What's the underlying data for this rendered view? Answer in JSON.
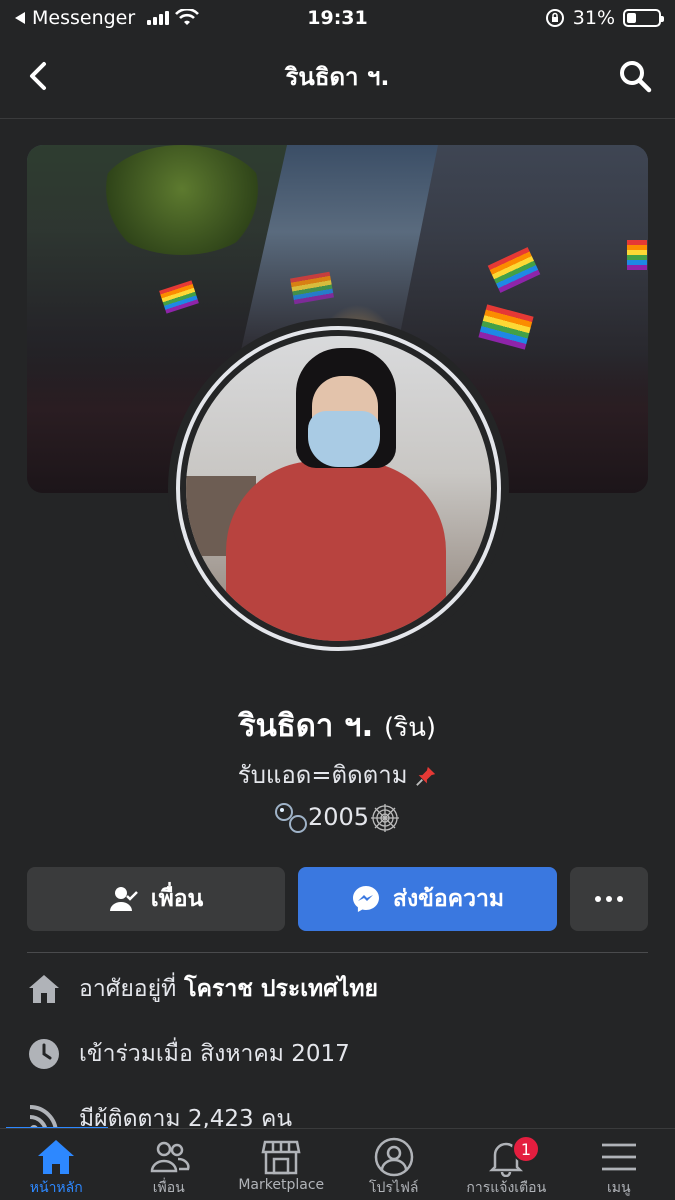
{
  "status_bar": {
    "back_app": "Messenger",
    "time": "19:31",
    "battery": "31%",
    "battery_level": 0.31
  },
  "nav": {
    "title": "รินธิดา ฯ."
  },
  "profile": {
    "name": "รินธิดา ฯ.",
    "nickname": "(ริน)",
    "bio_line1": "รับแอด=ติดตาม",
    "bio_line2": "2005"
  },
  "actions": {
    "friend_label": "เพื่อน",
    "message_label": "ส่งข้อความ"
  },
  "details": {
    "lives_prefix": "อาศัยอยู่ที่",
    "lives_value": "โคราช ประเทศไทย",
    "joined": "เข้าร่วมเมื่อ สิงหาคม  2017",
    "followers": "มีผู้ติดตาม 2,423 คน"
  },
  "tabs": [
    {
      "label": "หน้าหลัก",
      "icon": "home-icon",
      "active": true
    },
    {
      "label": "เพื่อน",
      "icon": "friends-icon",
      "active": false
    },
    {
      "label": "Marketplace",
      "icon": "marketplace-icon",
      "active": false
    },
    {
      "label": "โปรไฟล์",
      "icon": "profile-icon",
      "active": false
    },
    {
      "label": "การแจ้งเตือน",
      "icon": "bell-icon",
      "active": false,
      "badge": "1"
    },
    {
      "label": "เมนู",
      "icon": "menu-icon",
      "active": false
    }
  ],
  "colors": {
    "background": "#242526",
    "accent": "#2d88ff",
    "message_button": "#3a78e0",
    "badge": "#e41e3f"
  }
}
